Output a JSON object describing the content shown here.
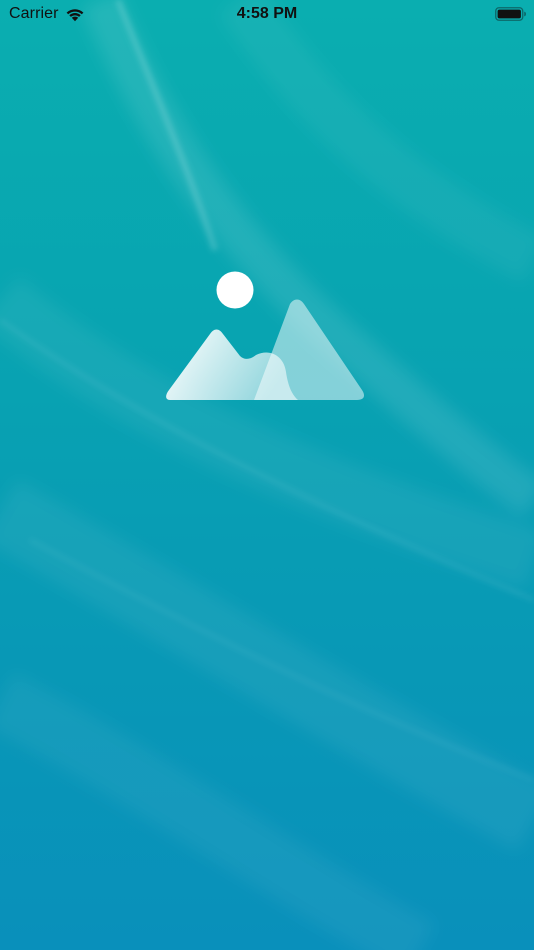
{
  "status_bar": {
    "carrier": "Carrier",
    "time": "4:58 PM",
    "wifi_icon": "wifi-icon",
    "battery_icon": "battery-icon"
  },
  "main": {
    "placeholder_icon": "image-placeholder-icon"
  },
  "colors": {
    "background_top": "#0aaeb0",
    "background_bottom": "#0990bb",
    "icon_white": "#ffffff",
    "status_text": "#111111"
  }
}
